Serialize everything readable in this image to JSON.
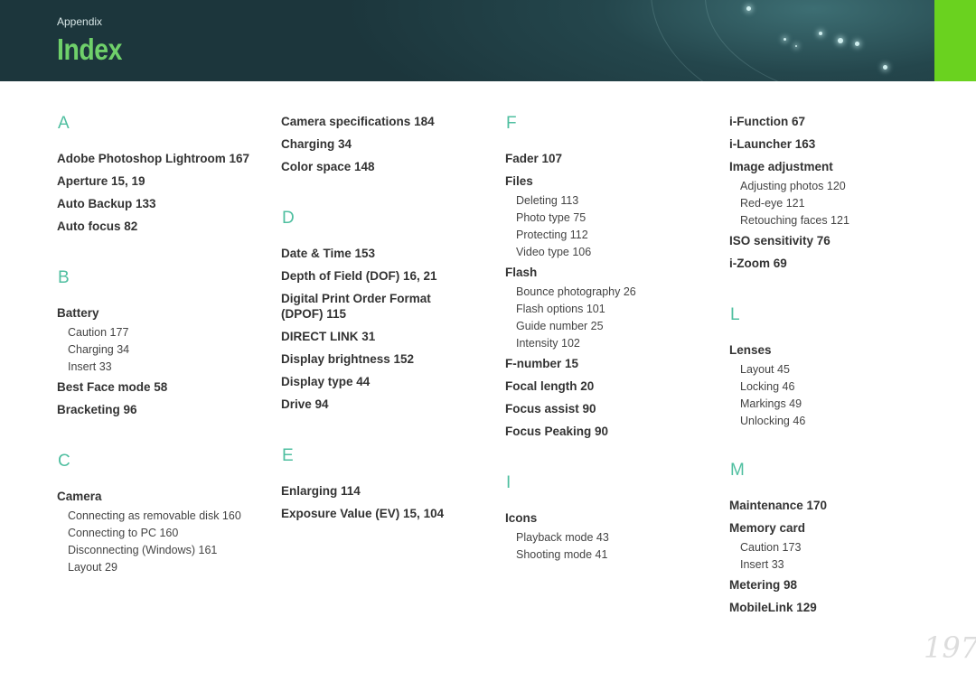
{
  "header": {
    "section": "Appendix",
    "title": "Index"
  },
  "col1": {
    "A": "A",
    "a1": "Adobe Photoshop Lightroom  167",
    "a2": "Aperture  15, 19",
    "a3": "Auto Backup  133",
    "a4": "Auto focus  82",
    "B": "B",
    "b1": "Battery",
    "b1s": [
      "Caution  177",
      "Charging  34",
      "Insert  33"
    ],
    "b2": "Best Face mode  58",
    "b3": "Bracketing  96",
    "C": "C",
    "c1": "Camera",
    "c1s": [
      "Connecting as removable disk  160",
      "Connecting to PC  160",
      "Disconnecting (Windows)  161",
      "Layout  29"
    ]
  },
  "col2": {
    "c2": "Camera specifications  184",
    "c3": "Charging  34",
    "c4": "Color space  148",
    "D": "D",
    "d1": "Date & Time  153",
    "d2": "Depth of Field (DOF)  16, 21",
    "d3a": "Digital Print Order Format",
    "d3b": "(DPOF)  115",
    "d4": "DIRECT LINK  31",
    "d5": "Display brightness  152",
    "d6": "Display type  44",
    "d7": "Drive  94",
    "E": "E",
    "e1": "Enlarging  114",
    "e2": "Exposure Value (EV)  15, 104"
  },
  "col3": {
    "F": "F",
    "f1": "Fader  107",
    "f2": "Files",
    "f2s": [
      "Deleting  113",
      "Photo type  75",
      "Protecting  112",
      "Video type  106"
    ],
    "f3": "Flash",
    "f3s": [
      "Bounce photography  26",
      "Flash options  101",
      "Guide number  25",
      "Intensity  102"
    ],
    "f4": "F-number  15",
    "f5": "Focal length  20",
    "f6": "Focus assist  90",
    "f7": "Focus Peaking  90",
    "I": "I",
    "i1": "Icons",
    "i1s": [
      "Playback mode  43",
      "Shooting mode  41"
    ]
  },
  "col4": {
    "i2": "i-Function  67",
    "i3": "i-Launcher  163",
    "i4": "Image adjustment",
    "i4s": [
      "Adjusting photos  120",
      "Red-eye  121",
      "Retouching faces  121"
    ],
    "i5": "ISO sensitivity  76",
    "i6": "i-Zoom  69",
    "L": "L",
    "l1": "Lenses",
    "l1s": [
      "Layout  45",
      "Locking  46",
      "Markings  49",
      "Unlocking  46"
    ],
    "M": "M",
    "m1": "Maintenance  170",
    "m2": "Memory card",
    "m2s": [
      "Caution  173",
      "Insert  33"
    ],
    "m3": "Metering  98",
    "m4": "MobileLink  129"
  },
  "page_number": "197"
}
